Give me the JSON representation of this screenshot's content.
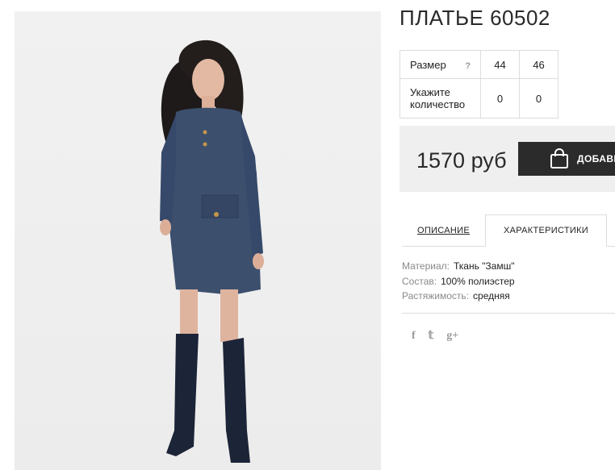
{
  "product": {
    "title": "ПЛАТЬЕ 60502"
  },
  "size_table": {
    "size_label": "Размер",
    "help_icon": "?",
    "sizes": [
      "44",
      "46"
    ],
    "quantity_label": "Укажите количество",
    "quantities": [
      "0",
      "0"
    ]
  },
  "purchase": {
    "price": "1570 руб",
    "add_button_label": "ДОБАВИ",
    "button_icon": "shopping-bag-icon"
  },
  "tabs": [
    {
      "label": "ОПИСАНИЕ",
      "active": false
    },
    {
      "label": "ХАРАКТЕРИСТИКИ",
      "active": true
    }
  ],
  "specs": [
    {
      "key": "Материал:",
      "value": "Ткань \"Замш\""
    },
    {
      "key": "Состав:",
      "value": "100% полиэстер"
    },
    {
      "key": "Растяжимость:",
      "value": "средняя"
    }
  ],
  "social": [
    {
      "icon": "facebook-icon",
      "glyph": "f"
    },
    {
      "icon": "twitter-icon",
      "glyph": "𝕥"
    },
    {
      "icon": "google-plus-icon",
      "glyph": "g+"
    }
  ],
  "colors": {
    "button_bg": "#2b2b2b",
    "price_bg": "#efefef",
    "dress": "#3c4f6d"
  }
}
